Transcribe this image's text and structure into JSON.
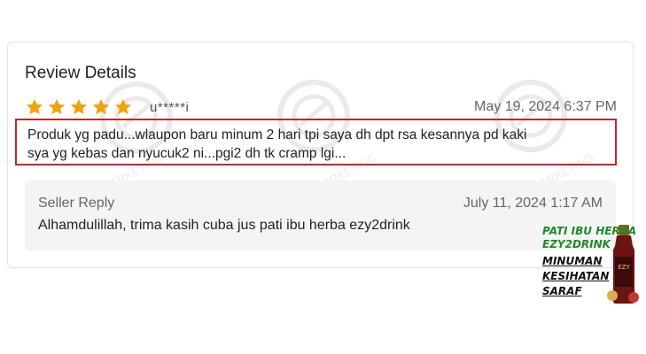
{
  "review": {
    "title": "Review Details",
    "rating": 5,
    "username": "u*****i",
    "date": "May 19, 2024 6:37 PM",
    "text_line1": "Produk yg padu...wlaupon baru minum 2 hari tpi saya dh dpt rsa kesannya pd kaki",
    "text_line2": "sya yg kebas dan nyucuk2 ni...pgi2 dh tk cramp lgi..."
  },
  "seller_reply": {
    "label": "Seller Reply",
    "date": "July 11, 2024 1:17 AM",
    "text": "Alhamdulillah, trima kasih cuba jus pati ibu herba ezy2drink"
  },
  "watermark": {
    "line1": "RASZQ MARKETING",
    "line2": "(KT0525289-V)"
  },
  "promo": {
    "line1": "PATI IBU HERBA",
    "line2": "EZY2DRINK",
    "line3": "MINUMAN",
    "line4": "KESIHATAN",
    "line5": "SARAF",
    "bottle_label": "EZY"
  },
  "colors": {
    "star": "#f0a30a",
    "highlight_border": "#c0262b",
    "seller_bg": "#f4f4f4"
  },
  "icons": {
    "star": "star-icon",
    "watermark_logo": "circle-logo-icon"
  }
}
